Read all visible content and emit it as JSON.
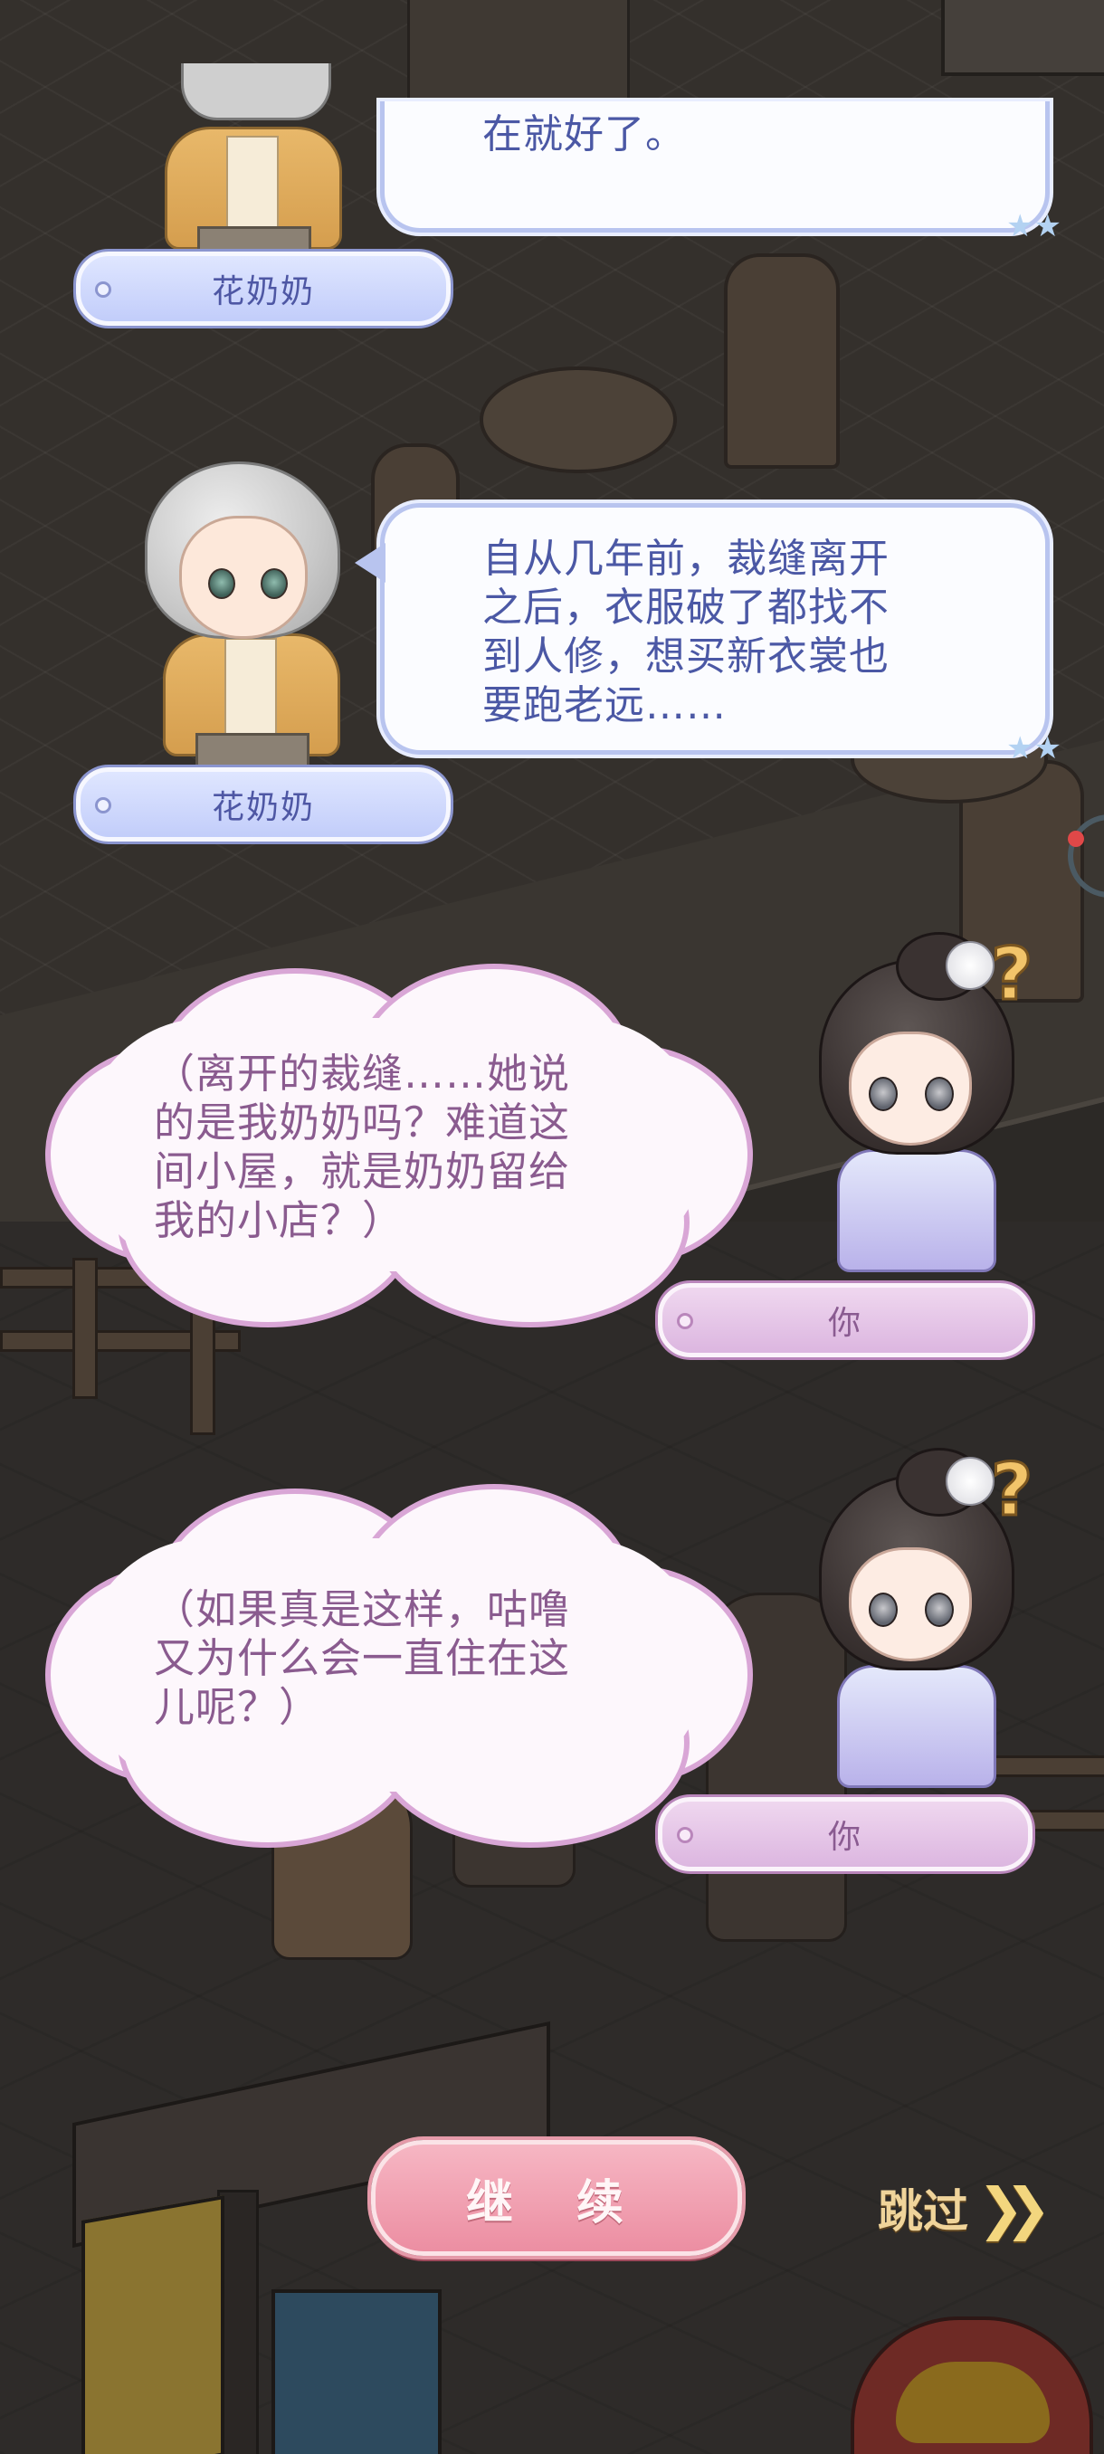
{
  "dialogue": [
    {
      "speaker": "花奶奶",
      "lines": [
        "在就好了。"
      ],
      "bubble_style": "speech-blue"
    },
    {
      "speaker": "花奶奶",
      "lines": [
        "自从几年前，裁缝离开",
        "之后，衣服破了都找不",
        "到人修，想买新衣裳也",
        "要跑老远……"
      ],
      "bubble_style": "speech-blue"
    },
    {
      "speaker": "你",
      "lines": [
        "（离开的裁缝……她说",
        "的是我奶奶吗？难道这",
        "间小屋，就是奶奶留给",
        "我的小店？）"
      ],
      "bubble_style": "thought-pink"
    },
    {
      "speaker": "你",
      "lines": [
        "（如果真是这样，咕噜",
        "又为什么会一直住在这",
        "儿呢？）"
      ],
      "bubble_style": "thought-pink"
    }
  ],
  "controls": {
    "continue_label": "继 续",
    "skip_label": "跳过",
    "skip_icon": "double-chevron-right"
  },
  "colors": {
    "npc_accent": "#4b58a5",
    "player_accent": "#8a5b8f",
    "continue_button": "#ec8ea2",
    "skip_text": "#f0d49a"
  }
}
